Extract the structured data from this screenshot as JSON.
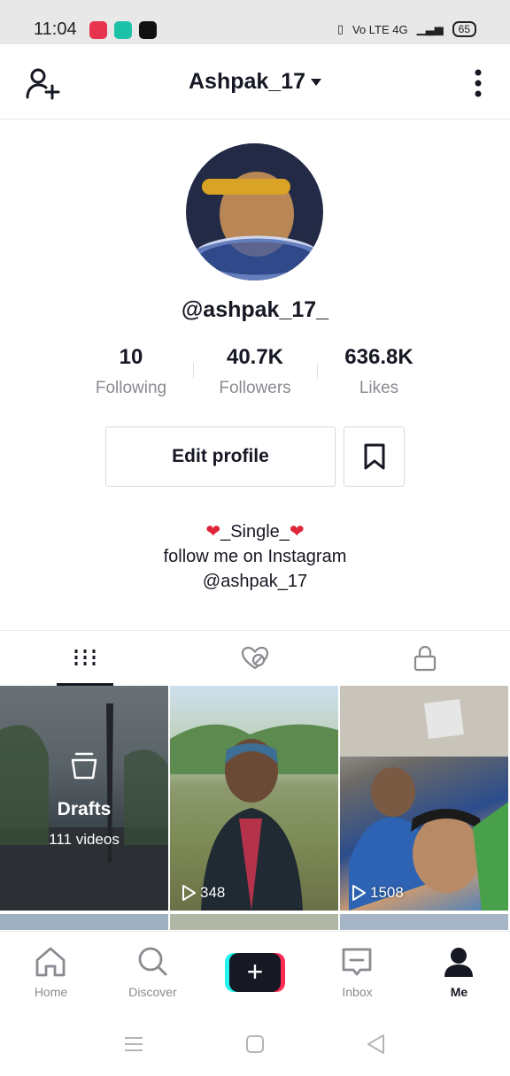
{
  "status_bar": {
    "time": "11:04",
    "network": "Vo LTE 4G",
    "battery": "65"
  },
  "header": {
    "username": "Ashpak_17"
  },
  "profile": {
    "handle": "@ashpak_17_",
    "stats": [
      {
        "value": "10",
        "label": "Following"
      },
      {
        "value": "40.7K",
        "label": "Followers"
      },
      {
        "value": "636.8K",
        "label": "Likes"
      }
    ],
    "edit_profile_label": "Edit profile",
    "bio": {
      "line1_text": "_Single_",
      "line2": "follow me on Instagram",
      "line3": "@ashpak_17"
    }
  },
  "tabs": [
    {
      "icon": "grid-icon",
      "active": true
    },
    {
      "icon": "liked-hidden-icon",
      "active": false
    },
    {
      "icon": "lock-icon",
      "active": false
    }
  ],
  "videos": {
    "drafts": {
      "title": "Drafts",
      "count_label": "111 videos"
    },
    "items": [
      {
        "views": "348"
      },
      {
        "views": "1508"
      }
    ]
  },
  "bottom_nav": {
    "home": "Home",
    "discover": "Discover",
    "inbox": "Inbox",
    "me": "Me"
  },
  "colors": {
    "accent_red": "#fe2c55",
    "accent_cyan": "#25f4ee",
    "text_dark": "#161823",
    "text_muted": "#8a8b91"
  }
}
